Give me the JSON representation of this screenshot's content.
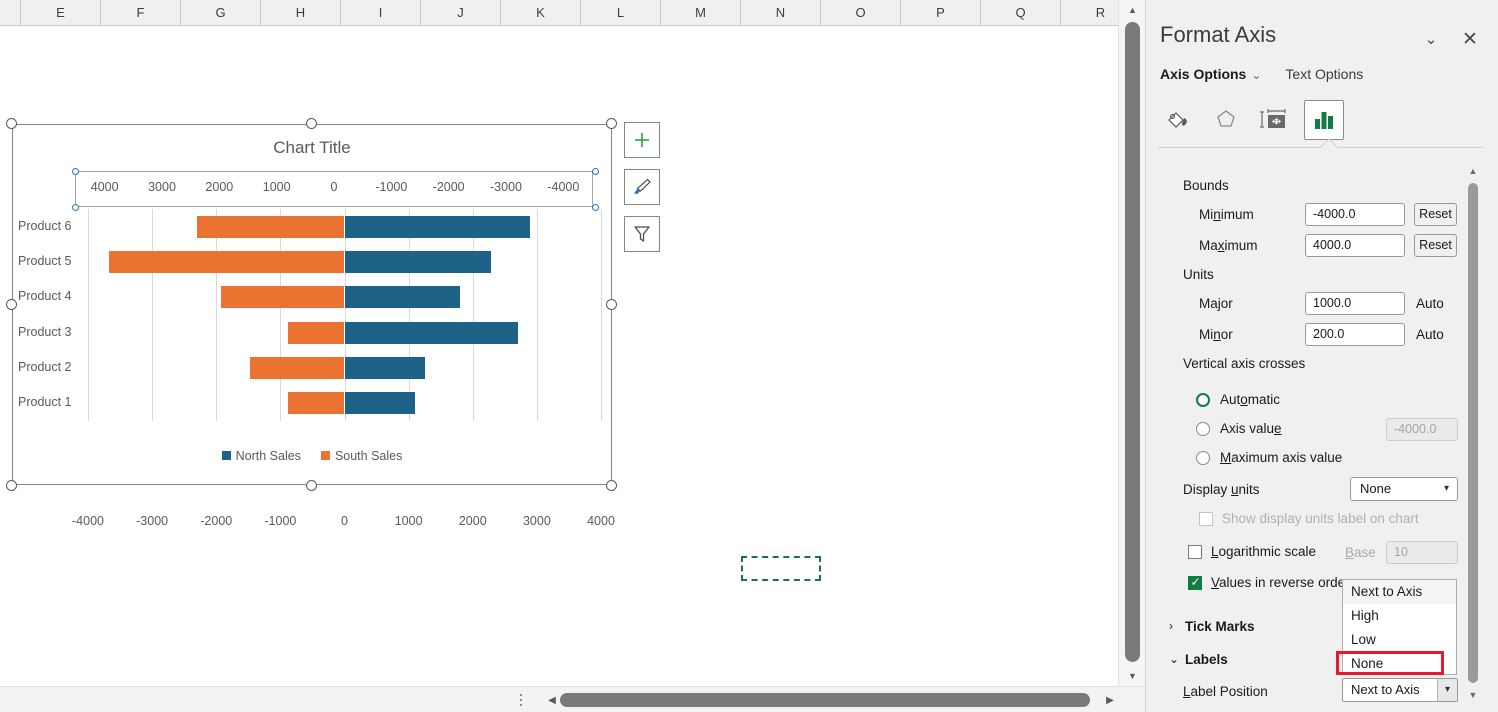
{
  "sheet": {
    "column_headers": [
      "E",
      "F",
      "G",
      "H",
      "I",
      "J",
      "K",
      "L",
      "M",
      "N",
      "O",
      "P",
      "Q",
      "R"
    ],
    "marching_ants_cell": "",
    "scroll_up_icon": "▲",
    "scroll_down_icon": "▼",
    "scroll_left_icon": "◀",
    "scroll_right_icon": "▶"
  },
  "chart_data": {
    "type": "bar",
    "title": "Chart Title",
    "orientation": "horizontal",
    "stacked": false,
    "categories": [
      "Product 1",
      "Product 2",
      "Product 3",
      "Product 4",
      "Product 5",
      "Product 6"
    ],
    "series": [
      {
        "name": "North Sales",
        "color": "#1f6287",
        "values": [
          1100,
          1250,
          2700,
          1800,
          2280,
          2900
        ]
      },
      {
        "name": "South Sales",
        "color": "#ea7331",
        "values": [
          -880,
          -1480,
          -880,
          -1920,
          -3670,
          -2300
        ]
      }
    ],
    "xlabel": "",
    "ylabel": "",
    "xlim": [
      -4000,
      4000
    ],
    "xticks": [
      "-4000",
      "-3000",
      "-2000",
      "-1000",
      "0",
      "1000",
      "2000",
      "3000",
      "4000"
    ],
    "secondary_top_axis_ticks": [
      "4000",
      "3000",
      "2000",
      "1000",
      "0",
      "-1000",
      "-2000",
      "-3000",
      "-4000"
    ],
    "grid": true,
    "legend_position": "bottom",
    "legend": [
      "North Sales",
      "South Sales"
    ]
  },
  "chart_buttons": [
    {
      "name": "chart-elements",
      "icon": "plus"
    },
    {
      "name": "chart-styles",
      "icon": "brush"
    },
    {
      "name": "chart-filters",
      "icon": "funnel"
    }
  ],
  "pane": {
    "title": "Format Axis",
    "collapse_icon": "⌄",
    "close_icon": "✕",
    "tabs": {
      "active": "Axis Options",
      "dropdown_icon": "⌄",
      "inactive": "Text Options"
    },
    "icon_tabs": [
      "fill-line-icon",
      "effects-icon",
      "size-properties-icon",
      "axis-options-icon"
    ],
    "bounds_label": "Bounds",
    "minimum_label": "Minimum",
    "minimum_value": "-4000.0",
    "minimum_reset": "Reset",
    "maximum_label": "Maximum",
    "maximum_value": "4000.0",
    "maximum_reset": "Reset",
    "units_label": "Units",
    "major_label": "Major",
    "major_value": "1000.0",
    "major_auto": "Auto",
    "minor_label": "Minor",
    "minor_value": "200.0",
    "minor_auto": "Auto",
    "vertical_axis_crosses_label": "Vertical axis crosses",
    "crosses_options": [
      {
        "label": "Automatic",
        "selected": true
      },
      {
        "label": "Axis value",
        "selected": false,
        "value": "-4000.0"
      },
      {
        "label": "Maximum axis value",
        "selected": false
      }
    ],
    "display_units_label": "Display units",
    "display_units_value": "None",
    "show_display_units_label": "Show display units label on chart",
    "show_display_units_checked": false,
    "logarithmic_label": "Logarithmic scale",
    "logarithmic_checked": false,
    "base_label": "Base",
    "base_value": "10",
    "reverse_order_label": "Values in reverse order",
    "reverse_order_checked": true,
    "tick_marks_header": "Tick Marks",
    "tick_marks_expanded": false,
    "labels_header": "Labels",
    "labels_expanded": true,
    "label_position_label": "Label Position",
    "label_position_value": "Next to Axis",
    "label_position_options": [
      "Next to Axis",
      "High",
      "Low",
      "None"
    ],
    "label_position_highlighted": "None",
    "highlight_color": "#e8192c",
    "accent_color": "#107c41"
  }
}
